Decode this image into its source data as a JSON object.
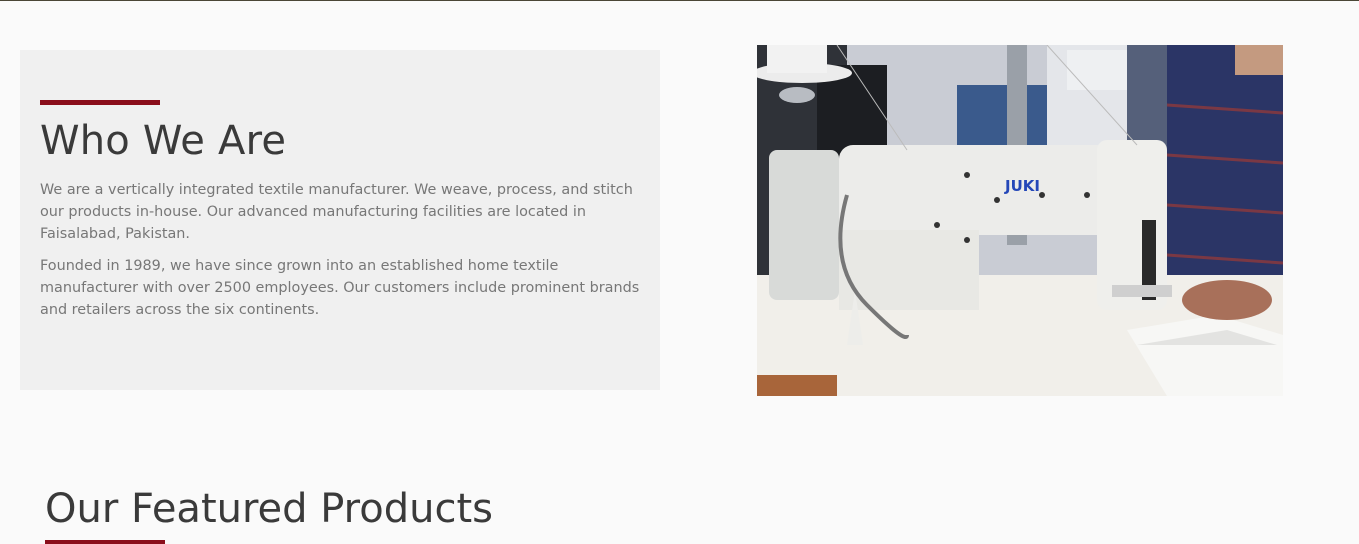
{
  "about": {
    "title": "Who We Are",
    "paragraph_1": "We are a vertically integrated textile manufacturer. We weave, process, and stitch our products in-house. Our advanced manufacturing facilities are located in Faisalabad, Pakistan.",
    "paragraph_2": "Founded in 1989, we have since grown into an established home textile manufacturer with over 2500 employees. Our customers include prominent brands and retailers across the six continents."
  },
  "photo": {
    "machine_brand": "JUKI"
  },
  "featured": {
    "title": "Our Featured Products"
  },
  "colors": {
    "accent": "#8a0e1b",
    "heading": "#3a3a3a",
    "body_text": "#777777",
    "panel_bg": "#f0f0f0",
    "page_bg": "#fafafa"
  }
}
